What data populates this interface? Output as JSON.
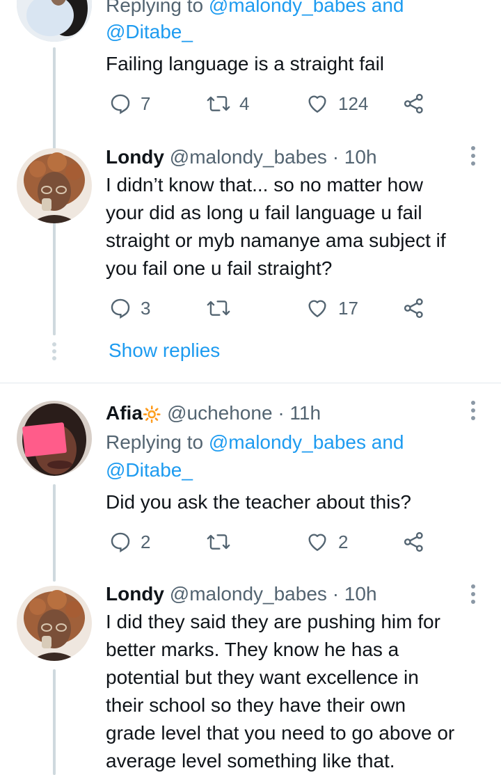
{
  "colors": {
    "accent": "#1d9bf0",
    "muted": "#536471",
    "thread_line": "#cfd9de"
  },
  "tweet1": {
    "reply_prefix": "Replying to",
    "reply_user1": "@malondy_babes",
    "reply_and": "and",
    "reply_user2": "@Ditabe_",
    "text": "Failing language is a straight fail",
    "replies": "7",
    "retweets": "4",
    "likes": "124"
  },
  "tweet2": {
    "name": "Londy",
    "handle": "@malondy_babes",
    "sep": "·",
    "time": "10h",
    "lines": [
      "I didn’t know that... so no matter how",
      "your did as long u fail language u fail",
      "straight or myb namanye ama subject if",
      "you fail one u fail straight?"
    ],
    "replies": "3",
    "retweets": "",
    "likes": "17"
  },
  "show_replies": "Show replies",
  "tweet3": {
    "name": "Afia",
    "name_emoji": "🔆",
    "handle": "@uchehone",
    "sep": "·",
    "time": "11h",
    "reply_prefix": "Replying to",
    "reply_user1": "@malondy_babes",
    "reply_and": "and",
    "reply_user2": "@Ditabe_",
    "text": "Did you ask the teacher about this?",
    "replies": "2",
    "retweets": "",
    "likes": "2"
  },
  "tweet4": {
    "name": "Londy",
    "handle": "@malondy_babes",
    "sep": "·",
    "time": "10h",
    "lines": [
      "I did they said they are pushing him for",
      "better marks. They know he has a",
      "potential but they want excellence in",
      "their school so they have their own",
      "grade level that you need to go above or",
      "average level something like that."
    ]
  },
  "icons": {
    "reply": "reply-icon",
    "retweet": "retweet-icon",
    "like": "heart-icon",
    "share": "share-icon",
    "more": "more-vertical-icon"
  }
}
